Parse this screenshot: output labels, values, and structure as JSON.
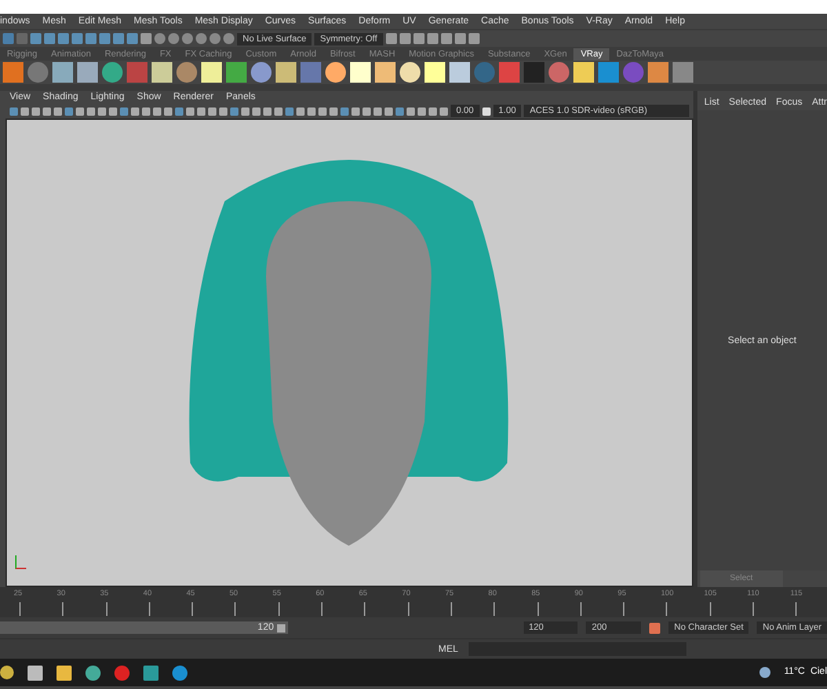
{
  "menu_bar": [
    "indows",
    "Mesh",
    "Edit Mesh",
    "Mesh Tools",
    "Mesh Display",
    "Curves",
    "Surfaces",
    "Deform",
    "UV",
    "Generate",
    "Cache",
    "Bonus Tools",
    "V-Ray",
    "Arnold",
    "Help"
  ],
  "status_line": {
    "live_surface": "No Live Surface",
    "symmetry": "Symmetry: Off"
  },
  "shelf_tabs": [
    {
      "label": "Rigging",
      "selected": false
    },
    {
      "label": "Animation",
      "selected": false
    },
    {
      "label": "Rendering",
      "selected": false
    },
    {
      "label": "FX",
      "selected": false
    },
    {
      "label": "FX Caching",
      "selected": false
    },
    {
      "label": "Custom",
      "selected": false
    },
    {
      "label": "Arnold",
      "selected": false
    },
    {
      "label": "Bifrost",
      "selected": false
    },
    {
      "label": "MASH",
      "selected": false
    },
    {
      "label": "Motion Graphics",
      "selected": false
    },
    {
      "label": "Substance",
      "selected": false
    },
    {
      "label": "XGen",
      "selected": false
    },
    {
      "label": "VRay",
      "selected": true
    },
    {
      "label": "DazToMaya",
      "selected": false
    }
  ],
  "panel_menu": [
    "View",
    "Shading",
    "Lighting",
    "Show",
    "Renderer",
    "Panels"
  ],
  "panel_toolbar": {
    "exposure": "0.00",
    "gamma": "1.00",
    "color_space": "ACES 1.0 SDR-video (sRGB)"
  },
  "attribute_editor": {
    "tabs": [
      "List",
      "Selected",
      "Focus",
      "Attr"
    ],
    "message": "Select an object",
    "button": "Select"
  },
  "time_slider": {
    "ticks": [
      "25",
      "30",
      "35",
      "40",
      "45",
      "50",
      "55",
      "60",
      "65",
      "70",
      "75",
      "80",
      "85",
      "90",
      "95",
      "100",
      "105",
      "110",
      "115"
    ]
  },
  "range_slider": {
    "level": 1,
    "current": "120",
    "end": "120",
    "max": "200",
    "character_set": "No Character Set",
    "anim_layer": "No Anim Layer"
  },
  "command_line": {
    "language": "MEL"
  },
  "taskbar": {
    "temperature": "11°C",
    "weather": "Ciel"
  }
}
